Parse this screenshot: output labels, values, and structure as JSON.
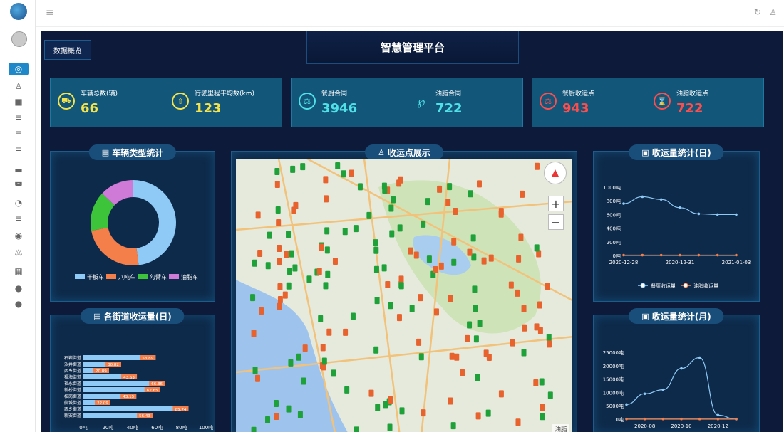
{
  "topbar": {
    "menu_icon": "hamburger-icon",
    "refresh_icon": "refresh-icon",
    "user_icon": "user-icon"
  },
  "sidebar": {
    "items": [
      {
        "icon": "dashboard-icon",
        "glyph": "◎",
        "active": true
      },
      {
        "icon": "person-icon",
        "glyph": "♙",
        "active": false
      },
      {
        "icon": "truck-icon",
        "glyph": "▣",
        "active": false
      },
      {
        "icon": "list-icon",
        "glyph": "≡",
        "active": false
      },
      {
        "icon": "list-icon",
        "glyph": "≡",
        "active": false
      },
      {
        "icon": "list-icon",
        "glyph": "≡",
        "active": false
      },
      {
        "icon": "car-icon",
        "glyph": "▬",
        "active": false
      },
      {
        "icon": "car-front-icon",
        "glyph": "◚",
        "active": false
      },
      {
        "icon": "chart-icon",
        "glyph": "◔",
        "active": false
      },
      {
        "icon": "list-icon",
        "glyph": "≡",
        "active": false
      },
      {
        "icon": "eye-icon",
        "glyph": "◉",
        "active": false
      },
      {
        "icon": "scale-icon",
        "glyph": "⚖",
        "active": false
      },
      {
        "icon": "building-icon",
        "glyph": "▦",
        "active": false
      },
      {
        "icon": "location-icon",
        "glyph": "●",
        "active": false
      },
      {
        "icon": "location-icon",
        "glyph": "●",
        "active": false
      }
    ]
  },
  "header": {
    "tab_overview": "数据概览",
    "title": "智慧管理平台"
  },
  "stats": [
    {
      "label": "车辆总数(辆)",
      "value": "66",
      "icon": "car-icon",
      "glyph": "🚗",
      "color": "#f5e34b"
    },
    {
      "label": "行驶里程平均数(km)",
      "value": "123",
      "icon": "upload-icon",
      "glyph": "⇧",
      "color": "#f5e34b"
    },
    {
      "label": "餐厨合同",
      "value": "3946",
      "icon": "scale-icon",
      "glyph": "⚖",
      "color": "#4fe0e8"
    },
    {
      "label": "油脂合同",
      "value": "722",
      "icon": "flask-icon",
      "glyph": "℘",
      "color": "#4fe0e8"
    },
    {
      "label": "餐厨收运点",
      "value": "943",
      "icon": "scale-icon",
      "glyph": "⚖",
      "color": "#ff4d4d"
    },
    {
      "label": "油脂收运点",
      "value": "722",
      "icon": "hourglass-icon",
      "glyph": "⌛",
      "color": "#ff4d4d"
    }
  ],
  "panels": {
    "vehicle_type": "车辆类型统计",
    "street_collection": "各街道收运量(日)",
    "map": "收运点展示",
    "daily_stats": "收运量统计(日)",
    "monthly_stats": "收运量统计(月)"
  },
  "map": {
    "credit": "油脂",
    "zoom_in": "+",
    "zoom_out": "−",
    "compass_glyph": "▲"
  },
  "colors": {
    "accent": "#1e88c8",
    "kitchen": "#e8622e",
    "oil": "#1fa13a"
  },
  "chart_data": [
    {
      "type": "pie",
      "title": "车辆类型统计",
      "categories": [
        "干板车",
        "八吨车",
        "勾臂车",
        "油脂车"
      ],
      "values": [
        48,
        24,
        15,
        13
      ],
      "colors": [
        "#8ecaf5",
        "#f57f4a",
        "#3ec43a",
        "#d07ad8"
      ],
      "legend": "bottom"
    },
    {
      "type": "bar",
      "title": "各街道收运量(日)",
      "orientation": "horizontal",
      "categories": [
        "石岩街道",
        "沙井街道",
        "西乡街道",
        "福海街道",
        "福永街道",
        "新桥街道",
        "松岗街道",
        "航城街道",
        "西乡街道",
        "新安街道"
      ],
      "values": [
        58.89,
        30.82,
        20.89,
        43.63,
        66.36,
        62.65,
        43.15,
        22.09,
        85.74,
        56.43
      ],
      "value_labels": [
        "58.89",
        "30.82",
        "20.89",
        "43.63",
        "66.36",
        "62.65",
        "43.15",
        "22.09",
        "85.74",
        "56.43"
      ],
      "xlim": [
        0,
        100
      ],
      "xticks": [
        "0吨",
        "20吨",
        "40吨",
        "60吨",
        "80吨",
        "100吨"
      ],
      "color": "#8ecaf5",
      "label_color": "#f57f4a"
    },
    {
      "type": "line",
      "title": "收运量统计(日)",
      "x": [
        "2020-12-28",
        "2020-12-29",
        "2020-12-30",
        "2020-12-31",
        "2021-01-01",
        "2021-01-02",
        "2021-01-03"
      ],
      "xticks": [
        "2020-12-28",
        "2020-12-31",
        "2021-01-03"
      ],
      "ylim": [
        0,
        1000
      ],
      "yticks": [
        "0吨",
        "200吨",
        "400吨",
        "600吨",
        "800吨",
        "1000吨"
      ],
      "series": [
        {
          "name": "餐厨收运量",
          "values": [
            760,
            860,
            820,
            700,
            610,
            600,
            600
          ],
          "color": "#8ecaf5"
        },
        {
          "name": "油脂收运量",
          "values": [
            5,
            5,
            5,
            5,
            5,
            5,
            5
          ],
          "color": "#f57f4a"
        }
      ],
      "legend": "bottom"
    },
    {
      "type": "line",
      "title": "收运量统计(月)",
      "x": [
        "2020-07",
        "2020-08",
        "2020-09",
        "2020-10",
        "2020-11",
        "2020-12",
        "2021-01"
      ],
      "xticks": [
        "2020-08",
        "2020-10",
        "2020-12"
      ],
      "ylim": [
        0,
        25000
      ],
      "yticks": [
        "0吨",
        "5000吨",
        "10000吨",
        "15000吨",
        "20000吨",
        "25000吨"
      ],
      "series": [
        {
          "name": "餐厨收运量",
          "values": [
            5500,
            9500,
            11000,
            19000,
            23000,
            1500,
            0
          ],
          "color": "#8ecaf5"
        },
        {
          "name": "油脂收运量",
          "values": [
            80,
            80,
            80,
            80,
            80,
            80,
            80
          ],
          "color": "#f57f4a"
        }
      ]
    }
  ]
}
